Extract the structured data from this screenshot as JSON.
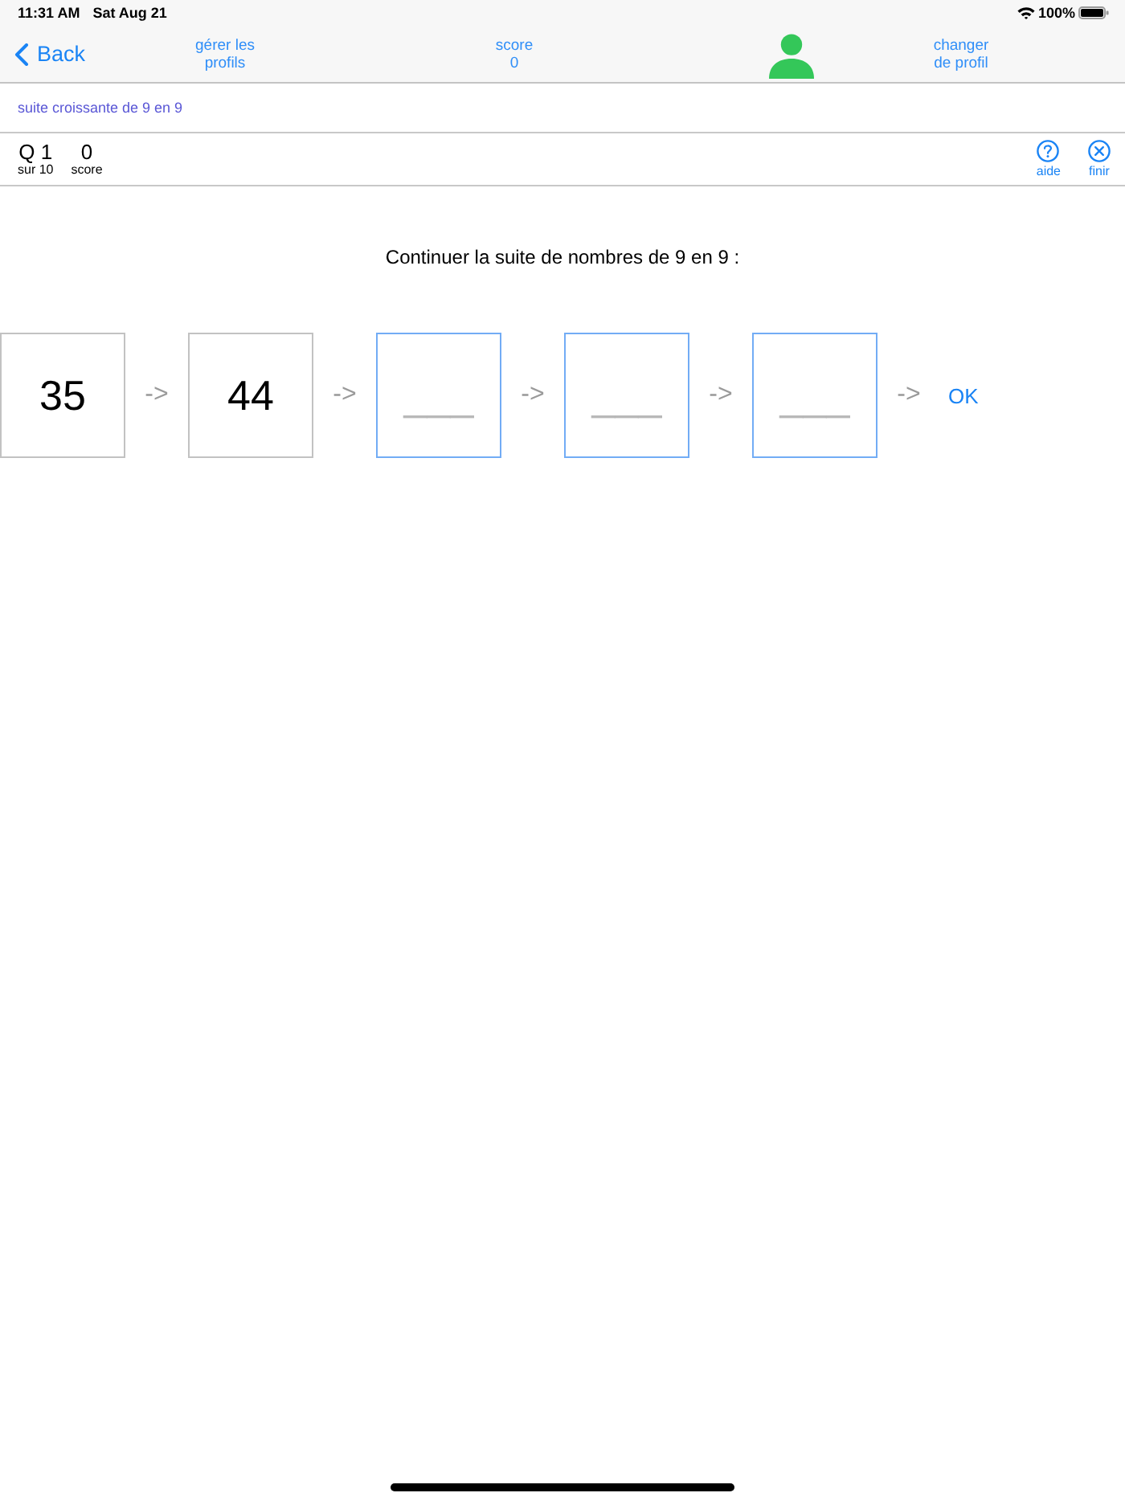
{
  "status_bar": {
    "time": "11:31 AM",
    "date": "Sat Aug 21",
    "battery": "100%"
  },
  "nav_bar": {
    "back": "Back",
    "manage_profiles": "gérer les profils",
    "score": {
      "label": "score",
      "value": "0"
    },
    "change_profile": "changer de profil"
  },
  "title": "suite croissante de 9 en 9",
  "progress": {
    "question": "Q 1",
    "total": "sur 10",
    "score": "0",
    "score_label": "score",
    "actions": [
      {
        "kind": "help",
        "label": "aide"
      },
      {
        "kind": "finish",
        "label": "finir"
      }
    ]
  },
  "exercise": {
    "prompt": "Continuer la suite de nombres de 9 en 9 :",
    "cells": [
      {
        "kind": "given",
        "value": "35",
        "arrow": "->"
      },
      {
        "kind": "given",
        "value": "44",
        "arrow": "->"
      },
      {
        "kind": "answer",
        "placeholder": "___",
        "arrow": "->"
      },
      {
        "kind": "answer",
        "placeholder": "___",
        "arrow": "->"
      },
      {
        "kind": "answer",
        "placeholder": "___",
        "arrow": "->"
      }
    ],
    "submit": "OK"
  }
}
